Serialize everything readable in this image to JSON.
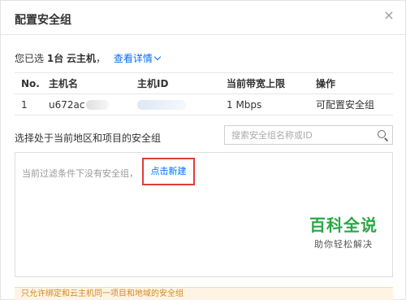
{
  "dialog": {
    "title": "配置安全组",
    "close_glyph": "×"
  },
  "selection": {
    "prefix": "您已选",
    "count": "1台",
    "type": "云主机",
    "suffix": "，",
    "details_link": "查看详情"
  },
  "table": {
    "headers": [
      "No.",
      "主机名",
      "主机ID",
      "当前带宽上限",
      "操作"
    ],
    "rows": [
      {
        "no": "1",
        "name": "u672ac",
        "id": "",
        "bandwidth": "1 Mbps",
        "action": "可配置安全组"
      }
    ]
  },
  "security_group": {
    "label": "选择处于当前地区和项目的安全组",
    "search_placeholder": "搜索安全组名称或ID",
    "empty_text": "当前过滤条件下没有安全组，",
    "create_link": "点击新建"
  },
  "watermark": {
    "title": "百科全说",
    "subtitle": "助你轻松解决"
  },
  "notice": {
    "text": "只允许绑定和云主机同一项目和地域的安全组"
  },
  "colors": {
    "link": "#006eff",
    "highlight_border": "#e03b3b",
    "watermark_green": "#2aa845",
    "notice_bg": "#fff4e3"
  }
}
